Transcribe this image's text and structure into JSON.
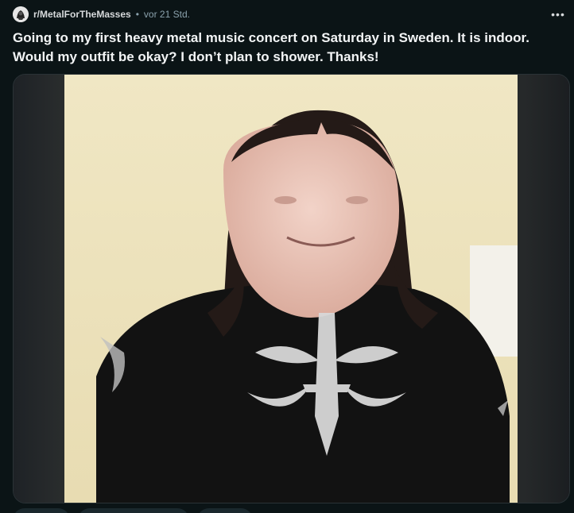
{
  "post": {
    "subreddit": "r/MetalForTheMasses",
    "separator": "•",
    "time": "vor 21 Std.",
    "more_label": "•••",
    "title": "Going to my first heavy metal music concert on Saturday in Sweden. It is indoor. Would my outfit be okay? I don’t plan to shower. Thanks!"
  },
  "icons": {
    "avatar": "subreddit-avatar",
    "more": "more-options-icon"
  },
  "colors": {
    "background": "#0b1416",
    "text": "#f2f4f5",
    "meta": "#8ba2ad"
  }
}
